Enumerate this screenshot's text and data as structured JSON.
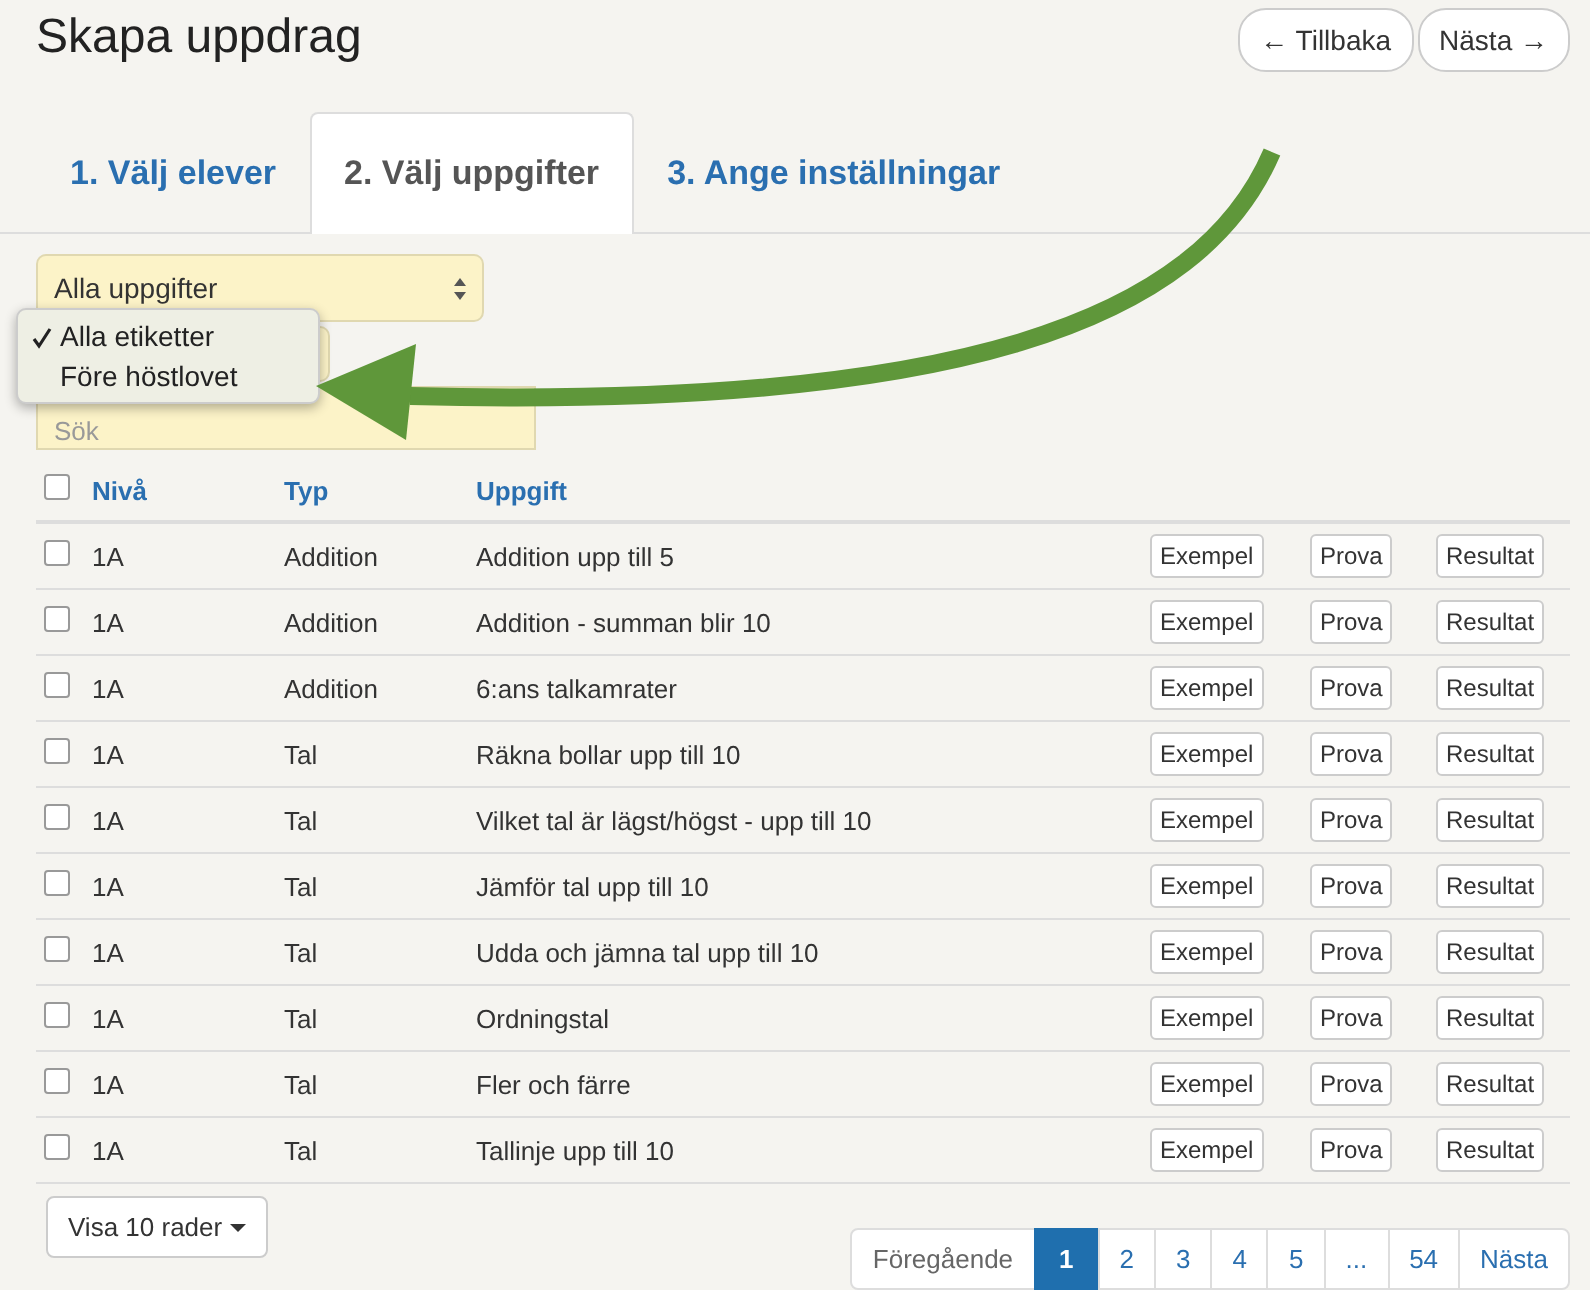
{
  "title": "Skapa uppdrag",
  "nav_buttons": [
    {
      "label": "← Tillbaka"
    },
    {
      "label": "Nästa →"
    }
  ],
  "tabs": [
    {
      "label": "1. Välj elever",
      "selected": false
    },
    {
      "label": "2. Välj uppgifter",
      "selected": true
    },
    {
      "label": "3. Ange inställningar",
      "selected": false
    }
  ],
  "filters": {
    "task_select": "Alla uppgifter",
    "tag_menu": [
      {
        "label": "Alla etiketter",
        "selected": true
      },
      {
        "label": "Före höstlovet",
        "selected": false
      }
    ],
    "search": {
      "placeholder": "Sök"
    }
  },
  "table": {
    "select_all": {
      "checked": false
    },
    "columns": [
      "Nivå",
      "Typ",
      "Uppgift"
    ],
    "rows": [
      {
        "checked": false,
        "level": "1A",
        "type": "Addition",
        "task": "Addition upp till 5",
        "actions": [
          "Exempel",
          "Prova",
          "Resultat"
        ]
      },
      {
        "checked": false,
        "level": "1A",
        "type": "Addition",
        "task": "Addition - summan blir 10",
        "actions": [
          "Exempel",
          "Prova",
          "Resultat"
        ]
      },
      {
        "checked": false,
        "level": "1A",
        "type": "Addition",
        "task": "6:ans talkamrater",
        "actions": [
          "Exempel",
          "Prova",
          "Resultat"
        ]
      },
      {
        "checked": false,
        "level": "1A",
        "type": "Tal",
        "task": "Räkna bollar upp till 10",
        "actions": [
          "Exempel",
          "Prova",
          "Resultat"
        ]
      },
      {
        "checked": false,
        "level": "1A",
        "type": "Tal",
        "task": "Vilket tal är lägst/högst - upp till 10",
        "actions": [
          "Exempel",
          "Prova",
          "Resultat"
        ]
      },
      {
        "checked": false,
        "level": "1A",
        "type": "Tal",
        "task": "Jämför tal upp till 10",
        "actions": [
          "Exempel",
          "Prova",
          "Resultat"
        ]
      },
      {
        "checked": false,
        "level": "1A",
        "type": "Tal",
        "task": "Udda och jämna tal upp till 10",
        "actions": [
          "Exempel",
          "Prova",
          "Resultat"
        ]
      },
      {
        "checked": false,
        "level": "1A",
        "type": "Tal",
        "task": "Ordningstal",
        "actions": [
          "Exempel",
          "Prova",
          "Resultat"
        ]
      },
      {
        "checked": false,
        "level": "1A",
        "type": "Tal",
        "task": "Fler och färre",
        "actions": [
          "Exempel",
          "Prova",
          "Resultat"
        ]
      },
      {
        "checked": false,
        "level": "1A",
        "type": "Tal",
        "task": "Tallinje upp till 10",
        "actions": [
          "Exempel",
          "Prova",
          "Resultat"
        ]
      }
    ]
  },
  "page_size": "Visa 10 rader",
  "pagination": {
    "previous": "Föregående",
    "pages": [
      {
        "label": "1",
        "selected": true
      },
      {
        "label": "2",
        "selected": false
      },
      {
        "label": "3",
        "selected": false
      },
      {
        "label": "4",
        "selected": false
      },
      {
        "label": "5",
        "selected": false
      },
      {
        "label": "...",
        "selected": false
      },
      {
        "label": "54",
        "selected": false
      }
    ],
    "next": "Nästa"
  }
}
